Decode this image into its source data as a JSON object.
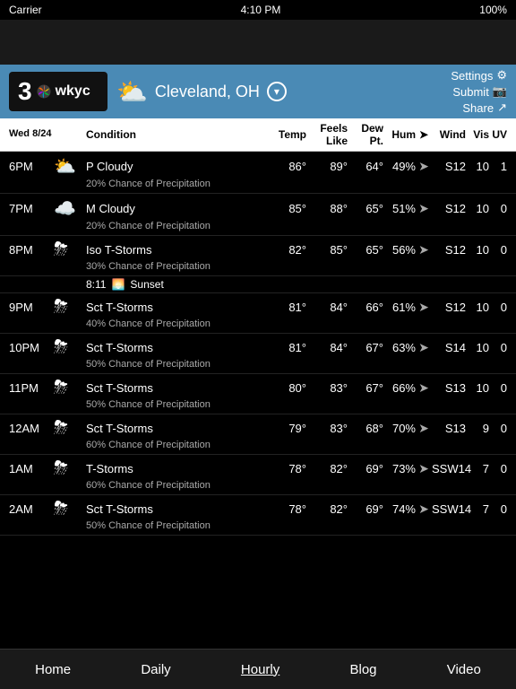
{
  "statusBar": {
    "carrier": "Carrier",
    "signal": "▲▼",
    "time": "4:10 PM",
    "battery": "100%"
  },
  "header": {
    "logoText": "3",
    "logoCall": "wkyc",
    "location": "Cleveland, OH",
    "settings": "Settings",
    "submit": "Submit",
    "share": "Share"
  },
  "columns": {
    "date": "Wed 8/24",
    "condition": "Condition",
    "temp": "Temp",
    "feelsLike": "Feels Like",
    "dewPt": "Dew Pt.",
    "hum": "Hum",
    "wind": "Wind",
    "vis": "Vis",
    "uv": "UV"
  },
  "rows": [
    {
      "time": "6PM",
      "icon": "⛅",
      "condition": "P Cloudy",
      "precip": "20% Chance of Precipitation",
      "temp": "86°",
      "feels": "89°",
      "dew": "64°",
      "hum": "49%",
      "wind": "S12",
      "vis": "10",
      "uv": "1"
    },
    {
      "time": "7PM",
      "icon": "☁️",
      "condition": "M Cloudy",
      "precip": "20% Chance of Precipitation",
      "temp": "85°",
      "feels": "88°",
      "dew": "65°",
      "hum": "51%",
      "wind": "S12",
      "vis": "10",
      "uv": "0"
    },
    {
      "time": "8PM",
      "icon": "⛈",
      "condition": "Iso T-Storms",
      "precip": "30% Chance of Precipitation",
      "temp": "82°",
      "feels": "85°",
      "dew": "65°",
      "hum": "56%",
      "wind": "S12",
      "vis": "10",
      "uv": "0",
      "sunset": {
        "time": "8:11",
        "label": "Sunset"
      }
    },
    {
      "time": "9PM",
      "icon": "⛈",
      "condition": "Sct T-Storms",
      "precip": "40% Chance of Precipitation",
      "temp": "81°",
      "feels": "84°",
      "dew": "66°",
      "hum": "61%",
      "wind": "S12",
      "vis": "10",
      "uv": "0"
    },
    {
      "time": "10PM",
      "icon": "⛈",
      "condition": "Sct T-Storms",
      "precip": "50% Chance of Precipitation",
      "temp": "81°",
      "feels": "84°",
      "dew": "67°",
      "hum": "63%",
      "wind": "S14",
      "vis": "10",
      "uv": "0"
    },
    {
      "time": "11PM",
      "icon": "⛈",
      "condition": "Sct T-Storms",
      "precip": "50% Chance of Precipitation",
      "temp": "80°",
      "feels": "83°",
      "dew": "67°",
      "hum": "66%",
      "wind": "S13",
      "vis": "10",
      "uv": "0"
    },
    {
      "time": "12AM",
      "icon": "⛈",
      "condition": "Sct T-Storms",
      "precip": "60% Chance of Precipitation",
      "temp": "79°",
      "feels": "83°",
      "dew": "68°",
      "hum": "70%",
      "wind": "S13",
      "vis": "9",
      "uv": "0"
    },
    {
      "time": "1AM",
      "icon": "⛈",
      "condition": "T-Storms",
      "precip": "60% Chance of Precipitation",
      "temp": "78°",
      "feels": "82°",
      "dew": "69°",
      "hum": "73%",
      "wind": "SSW14",
      "vis": "7",
      "uv": "0"
    },
    {
      "time": "2AM",
      "icon": "⛈",
      "condition": "Sct T-Storms",
      "precip": "50% Chance of Precipitation",
      "temp": "78°",
      "feels": "82°",
      "dew": "69°",
      "hum": "74%",
      "wind": "SSW14",
      "vis": "7",
      "uv": "0"
    }
  ],
  "nav": {
    "items": [
      {
        "label": "Home",
        "active": false
      },
      {
        "label": "Daily",
        "active": false
      },
      {
        "label": "Hourly",
        "active": true
      },
      {
        "label": "Blog",
        "active": false
      },
      {
        "label": "Video",
        "active": false
      }
    ]
  }
}
